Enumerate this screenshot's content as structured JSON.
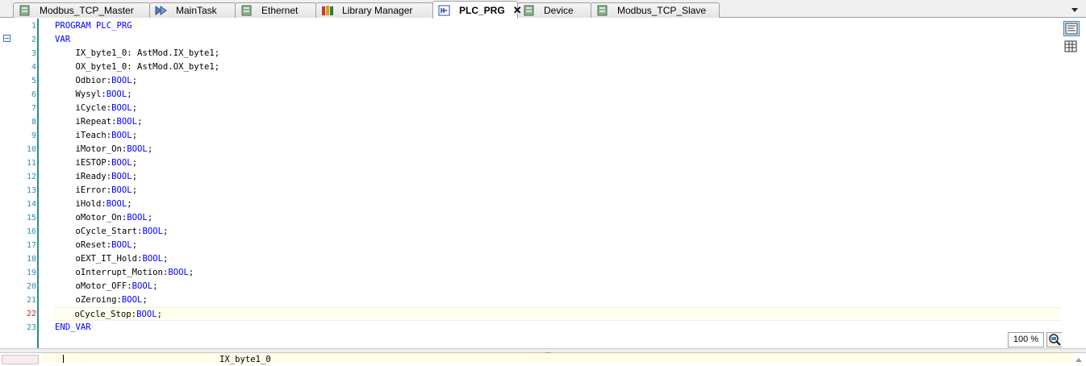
{
  "tabs": [
    {
      "label": "Modbus_TCP_Master",
      "icon": "device-icon"
    },
    {
      "label": "MainTask",
      "icon": "task-icon"
    },
    {
      "label": "Ethernet",
      "icon": "device-icon"
    },
    {
      "label": "Library Manager",
      "icon": "library-icon"
    },
    {
      "label": "PLC_PRG",
      "icon": "pou-icon",
      "active": true,
      "close": "✕"
    },
    {
      "label": "Device",
      "icon": "device-icon"
    },
    {
      "label": "Modbus_TCP_Slave",
      "icon": "device-icon"
    }
  ],
  "editor": {
    "line_numbers": [
      "1",
      "2",
      "3",
      "4",
      "5",
      "6",
      "7",
      "8",
      "9",
      "10",
      "11",
      "12",
      "13",
      "14",
      "15",
      "16",
      "17",
      "18",
      "19",
      "20",
      "21",
      "22",
      "23"
    ],
    "current_line": "22",
    "lines": [
      [
        {
          "t": "PROGRAM PLC_PRG",
          "kw": true
        }
      ],
      [
        {
          "t": "VAR",
          "kw": true
        }
      ],
      [
        {
          "t": "    IX_byte1_0: AstMod.IX_byte1;"
        }
      ],
      [
        {
          "t": "    OX_byte1_0: AstMod.OX_byte1;"
        }
      ],
      [
        {
          "t": "    Odbior:"
        },
        {
          "t": "BOOL",
          "kw": true
        },
        {
          "t": ";"
        }
      ],
      [
        {
          "t": "    Wysyl:"
        },
        {
          "t": "BOOL",
          "kw": true
        },
        {
          "t": ";"
        }
      ],
      [
        {
          "t": "    iCycle:"
        },
        {
          "t": "BOOL",
          "kw": true
        },
        {
          "t": ";"
        }
      ],
      [
        {
          "t": "    iRepeat:"
        },
        {
          "t": "BOOL",
          "kw": true
        },
        {
          "t": ";"
        }
      ],
      [
        {
          "t": "    iTeach:"
        },
        {
          "t": "BOOL",
          "kw": true
        },
        {
          "t": ";"
        }
      ],
      [
        {
          "t": "    iMotor_On:"
        },
        {
          "t": "BOOL",
          "kw": true
        },
        {
          "t": ";"
        }
      ],
      [
        {
          "t": "    iESTOP:"
        },
        {
          "t": "BOOL",
          "kw": true
        },
        {
          "t": ";"
        }
      ],
      [
        {
          "t": "    iReady:"
        },
        {
          "t": "BOOL",
          "kw": true
        },
        {
          "t": ";"
        }
      ],
      [
        {
          "t": "    iError:"
        },
        {
          "t": "BOOL",
          "kw": true
        },
        {
          "t": ";"
        }
      ],
      [
        {
          "t": "    iHold:"
        },
        {
          "t": "BOOL",
          "kw": true
        },
        {
          "t": ";"
        }
      ],
      [
        {
          "t": "    oMotor_On:"
        },
        {
          "t": "BOOL",
          "kw": true
        },
        {
          "t": ";"
        }
      ],
      [
        {
          "t": "    oCycle_Start:"
        },
        {
          "t": "BOOL",
          "kw": true
        },
        {
          "t": ";"
        }
      ],
      [
        {
          "t": "    oReset:"
        },
        {
          "t": "BOOL",
          "kw": true
        },
        {
          "t": ";"
        }
      ],
      [
        {
          "t": "    oEXT_IT_Hold:"
        },
        {
          "t": "BOOL",
          "kw": true
        },
        {
          "t": ";"
        }
      ],
      [
        {
          "t": "    oInterrupt_Motion:"
        },
        {
          "t": "BOOL",
          "kw": true
        },
        {
          "t": ";"
        }
      ],
      [
        {
          "t": "    oMotor_OFF:"
        },
        {
          "t": "BOOL",
          "kw": true
        },
        {
          "t": ";"
        }
      ],
      [
        {
          "t": "    oZeroing:"
        },
        {
          "t": "BOOL",
          "kw": true
        },
        {
          "t": ";"
        }
      ],
      [
        {
          "t": "    oCycle_Stop:"
        },
        {
          "t": "BOOL",
          "kw": true
        },
        {
          "t": ";"
        }
      ],
      [
        {
          "t": "END_VAR",
          "kw": true
        }
      ]
    ],
    "zoom": "100 %"
  },
  "bottom_pane": {
    "declaration_text": "IX_byte1_0"
  },
  "colors": {
    "keyword": "#0000ff",
    "line_number": "#2b91af",
    "current_line_number": "#d02020",
    "gutter_border": "#2a8b8b",
    "current_line_bg": "#fffff0"
  }
}
